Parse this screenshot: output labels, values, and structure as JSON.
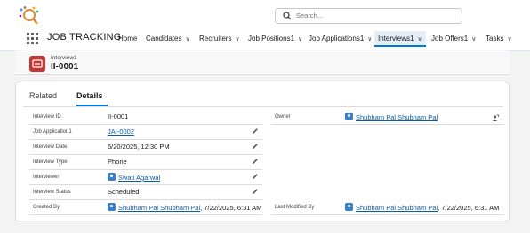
{
  "search": {
    "placeholder": "Search..."
  },
  "app": {
    "name": "JOB TRACKING"
  },
  "nav": [
    {
      "label": "Home",
      "has_menu": false
    },
    {
      "label": "Candidates",
      "has_menu": true
    },
    {
      "label": "Recruiters",
      "has_menu": true
    },
    {
      "label": "Job Positions1",
      "has_menu": true
    },
    {
      "label": "Job Applications1",
      "has_menu": true
    },
    {
      "label": "Interviews1",
      "has_menu": true,
      "active": true
    },
    {
      "label": "Job Offers1",
      "has_menu": true
    },
    {
      "label": "Tasks",
      "has_menu": true
    }
  ],
  "record": {
    "object_label": "Interview1",
    "title": "II-0001"
  },
  "tabs": {
    "related": "Related",
    "details": "Details"
  },
  "fields": {
    "interview_id": {
      "label": "Interview ID",
      "value": "II-0001"
    },
    "job_application": {
      "label": "Job Application1",
      "value": "JAI-0002"
    },
    "interview_date": {
      "label": "Interview Date",
      "value": "6/20/2025, 12:30 PM"
    },
    "interview_type": {
      "label": "Interview Type",
      "value": "Phone"
    },
    "interviewer": {
      "label": "Interviewer",
      "value": "Swati Agarwal"
    },
    "interview_status": {
      "label": "Interview Status",
      "value": "Scheduled"
    },
    "created_by": {
      "label": "Created By",
      "user": "Shubham Pal Shubham Pal",
      "date": ", 7/22/2025, 6:31 AM"
    },
    "owner": {
      "label": "Owner",
      "value": "Shubham Pal Shubham Pal"
    },
    "last_modified_by": {
      "label": "Last Modified By",
      "user": "Shubham Pal Shubham Pal",
      "date": ", 7/22/2025, 6:31 AM"
    }
  },
  "colors": {
    "accent": "#0176d3",
    "link": "#0b5cab",
    "record_icon": "#c23934",
    "user_icon": "#3b7fc4"
  },
  "icons": [
    "magnifier-logo-icon",
    "search-icon",
    "app-launcher-icon",
    "chevron-down-icon",
    "record-icon",
    "pencil-icon",
    "user-icon",
    "change-owner-icon"
  ]
}
